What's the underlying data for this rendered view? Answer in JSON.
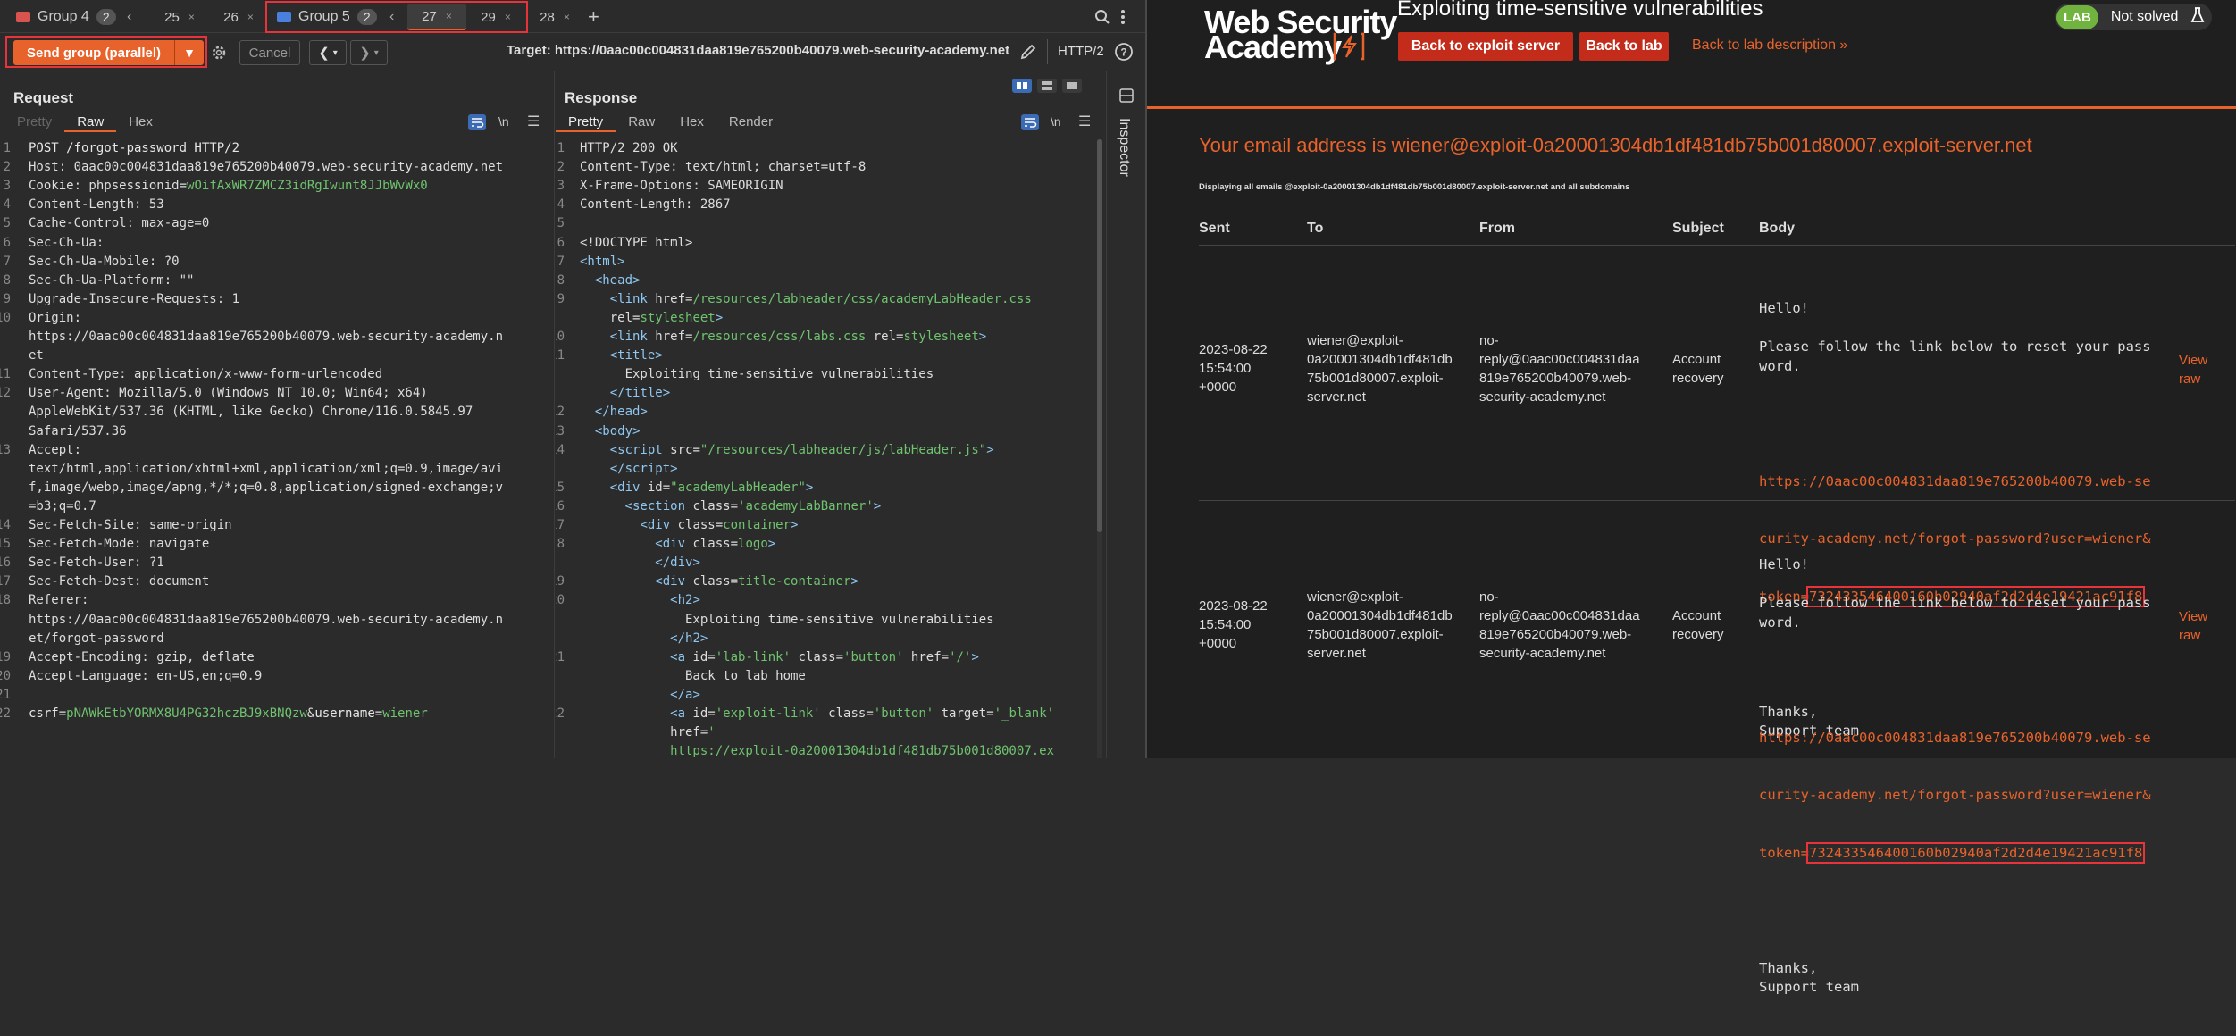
{
  "tabbar": {
    "group4": {
      "name": "Group 4",
      "count": "2"
    },
    "tab25": "25",
    "tab26": "26",
    "group5": {
      "name": "Group 5",
      "count": "2"
    },
    "tab27": "27",
    "tab29": "29",
    "tab28": "28",
    "close": "×",
    "add": "+",
    "prev": "‹"
  },
  "toolbar": {
    "send_label": "Send group (parallel)",
    "cancel_label": "Cancel",
    "target_label": "Target: https://0aac00c004831daa819e765200b40079.web-security-academy.net",
    "http_version": "HTTP/2"
  },
  "request": {
    "title": "Request",
    "tabs": [
      "Pretty",
      "Raw",
      "Hex"
    ],
    "newline_toggle": "\\n",
    "lines": [
      {
        "n": "1",
        "html": "<span class='k'>POST /forgot-password HTTP/2</span>"
      },
      {
        "n": "2",
        "html": "Host: 0aac00c004831daa819e765200b40079.web-security-academy.net"
      },
      {
        "n": "3",
        "html": "Cookie: phpsessionid=<span class='v'>wOifAxWR7ZMCZ3idRgIwunt8JJbWvWx0</span>"
      },
      {
        "n": "4",
        "html": "Content-Length: 53"
      },
      {
        "n": "5",
        "html": "Cache-Control: max-age=0"
      },
      {
        "n": "6",
        "html": "Sec-Ch-Ua: "
      },
      {
        "n": "7",
        "html": "Sec-Ch-Ua-Mobile: ?0"
      },
      {
        "n": "8",
        "html": "Sec-Ch-Ua-Platform: \"\""
      },
      {
        "n": "9",
        "html": "Upgrade-Insecure-Requests: 1"
      },
      {
        "n": "10",
        "html": "Origin: "
      },
      {
        "n": "",
        "html": "https://0aac00c004831daa819e765200b40079.web-security-academy.n"
      },
      {
        "n": "",
        "html": "et"
      },
      {
        "n": "11",
        "html": "Content-Type: application/x-www-form-urlencoded"
      },
      {
        "n": "12",
        "html": "User-Agent: Mozilla/5.0 (Windows NT 10.0; Win64; x64)"
      },
      {
        "n": "",
        "html": "AppleWebKit/537.36 (KHTML, like Gecko) Chrome/116.0.5845.97"
      },
      {
        "n": "",
        "html": "Safari/537.36"
      },
      {
        "n": "13",
        "html": "Accept: "
      },
      {
        "n": "",
        "html": "text/html,application/xhtml+xml,application/xml;q=0.9,image/avi"
      },
      {
        "n": "",
        "html": "f,image/webp,image/apng,*/*;q=0.8,application/signed-exchange;v"
      },
      {
        "n": "",
        "html": "=b3;q=0.7"
      },
      {
        "n": "14",
        "html": "Sec-Fetch-Site: same-origin"
      },
      {
        "n": "15",
        "html": "Sec-Fetch-Mode: navigate"
      },
      {
        "n": "16",
        "html": "Sec-Fetch-User: ?1"
      },
      {
        "n": "17",
        "html": "Sec-Fetch-Dest: document"
      },
      {
        "n": "18",
        "html": "Referer: "
      },
      {
        "n": "",
        "html": "https://0aac00c004831daa819e765200b40079.web-security-academy.n"
      },
      {
        "n": "",
        "html": "et/forgot-password"
      },
      {
        "n": "19",
        "html": "Accept-Encoding: gzip, deflate"
      },
      {
        "n": "20",
        "html": "Accept-Language: en-US,en;q=0.9"
      },
      {
        "n": "21",
        "html": ""
      },
      {
        "n": "22",
        "html": "<span class='k'>csrf</span>=<span class='v'>pNAWkEtbYORMX8U4PG32hczBJ9xBNQzw</span>&amp;<span class='k'>username</span>=<span class='v'>wiener</span>"
      }
    ]
  },
  "response": {
    "title": "Response",
    "tabs": [
      "Pretty",
      "Raw",
      "Hex",
      "Render"
    ],
    "newline_toggle": "\\n",
    "lines": [
      {
        "n": "1",
        "html": "HTTP/2 200 OK"
      },
      {
        "n": "2",
        "html": "Content-Type: text/html; charset=utf-8"
      },
      {
        "n": "3",
        "html": "X-Frame-Options: SAMEORIGIN"
      },
      {
        "n": "4",
        "html": "Content-Length: 2867"
      },
      {
        "n": "5",
        "html": ""
      },
      {
        "n": "6",
        "html": "&lt;!DOCTYPE html&gt;"
      },
      {
        "n": "7",
        "html": "<span class='tag'>&lt;html&gt;</span>"
      },
      {
        "n": "8",
        "html": "  <span class='tag'>&lt;head&gt;</span>"
      },
      {
        "n": "9",
        "html": "    <span class='tag'>&lt;link</span> href=<span class='str'>/resources/labheader/css/academyLabHeader.css</span>"
      },
      {
        "n": "",
        "html": "    rel=<span class='str'>stylesheet</span><span class='tag'>&gt;</span>"
      },
      {
        "n": "10",
        "html": "    <span class='tag'>&lt;link</span> href=<span class='str'>/resources/css/labs.css</span> rel=<span class='str'>stylesheet</span><span class='tag'>&gt;</span>"
      },
      {
        "n": "11",
        "html": "    <span class='tag'>&lt;title&gt;</span>"
      },
      {
        "n": "",
        "html": "      Exploiting time-sensitive vulnerabilities"
      },
      {
        "n": "",
        "html": "    <span class='tag'>&lt;/title&gt;</span>"
      },
      {
        "n": "12",
        "html": "  <span class='tag'>&lt;/head&gt;</span>"
      },
      {
        "n": "13",
        "html": "  <span class='tag'>&lt;body&gt;</span>"
      },
      {
        "n": "14",
        "html": "    <span class='tag'>&lt;script</span> src=<span class='str'>\"/resources/labheader/js/labHeader.js\"</span><span class='tag'>&gt;</span>"
      },
      {
        "n": "",
        "html": "    <span class='tag'>&lt;/script&gt;</span>"
      },
      {
        "n": "15",
        "html": "    <span class='tag'>&lt;div</span> id=<span class='str'>\"academyLabHeader\"</span><span class='tag'>&gt;</span>"
      },
      {
        "n": "16",
        "html": "      <span class='tag'>&lt;section</span> class=<span class='str'>'academyLabBanner'</span><span class='tag'>&gt;</span>"
      },
      {
        "n": "17",
        "html": "        <span class='tag'>&lt;div</span> class=<span class='str'>container</span><span class='tag'>&gt;</span>"
      },
      {
        "n": "18",
        "html": "          <span class='tag'>&lt;div</span> class=<span class='str'>logo</span><span class='tag'>&gt;</span>"
      },
      {
        "n": "",
        "html": "          <span class='tag'>&lt;/div&gt;</span>"
      },
      {
        "n": "19",
        "html": "          <span class='tag'>&lt;div</span> class=<span class='str'>title-container</span><span class='tag'>&gt;</span>"
      },
      {
        "n": "20",
        "html": "            <span class='tag'>&lt;h2&gt;</span>"
      },
      {
        "n": "",
        "html": "              Exploiting time-sensitive vulnerabilities"
      },
      {
        "n": "",
        "html": "            <span class='tag'>&lt;/h2&gt;</span>"
      },
      {
        "n": "21",
        "html": "            <span class='tag'>&lt;a</span> id=<span class='str'>'lab-link'</span> class=<span class='str'>'button'</span> href=<span class='str'>'/'</span><span class='tag'>&gt;</span>"
      },
      {
        "n": "",
        "html": "              Back to lab home"
      },
      {
        "n": "",
        "html": "            <span class='tag'>&lt;/a&gt;</span>"
      },
      {
        "n": "22",
        "html": "            <span class='tag'>&lt;a</span> id=<span class='str'>'exploit-link'</span> class=<span class='str'>'button'</span> target=<span class='str'>'_blank'</span>"
      },
      {
        "n": "",
        "html": "            href=<span class='str'>'</span>"
      },
      {
        "n": "",
        "html": "<span class='str'>            https://exploit-0a20001304db1df481db75b001d80007.ex</span>"
      }
    ]
  },
  "inspector": {
    "label": "Inspector"
  },
  "lab": {
    "logo_line1": "Web Security",
    "logo_line2": "Academy",
    "title": "Exploiting time-sensitive vulnerabilities",
    "back_exploit": "Back to exploit server",
    "back_lab": "Back to lab",
    "back_desc": "Back to lab description »",
    "lab_badge": "LAB",
    "status": "Not solved",
    "email_heading": "Your email address is wiener@exploit-0a20001304db1df481db75b001d80007.exploit-server.net",
    "email_sub": "Displaying all emails @exploit-0a20001304db1df481db75b001d80007.exploit-server.net and all subdomains",
    "columns": [
      "Sent",
      "To",
      "From",
      "Subject",
      "Body"
    ],
    "emails": [
      {
        "sent": "2023-08-22\n15:54:00\n+0000",
        "to": "wiener@exploit-\n0a20001304db1df481db\n75b001d80007.exploit-\nserver.net",
        "from": "no-\nreply@0aac00c004831daa\n819e765200b40079.web-\nsecurity-academy.net",
        "subject": "Account\nrecovery",
        "body_pre": "Hello!\n\nPlease follow the link below to reset your pass\nword.",
        "link_l1": "https://0aac00c004831daa819e765200b40079.web-se",
        "link_l2": "curity-academy.net/forgot-password?user=wiener&",
        "link_l3_pre": "token=",
        "token": "732433546400160b02940af2d2d4e19421ac91f8",
        "body_post": "Thanks,\nSupport team",
        "view_raw": "View\nraw"
      },
      {
        "sent": "2023-08-22\n15:54:00\n+0000",
        "to": "wiener@exploit-\n0a20001304db1df481db\n75b001d80007.exploit-\nserver.net",
        "from": "no-\nreply@0aac00c004831daa\n819e765200b40079.web-\nsecurity-academy.net",
        "subject": "Account\nrecovery",
        "body_pre": "Hello!\n\nPlease follow the link below to reset your pass\nword.",
        "link_l1": "https://0aac00c004831daa819e765200b40079.web-se",
        "link_l2": "curity-academy.net/forgot-password?user=wiener&",
        "link_l3_pre": "token=",
        "token": "732433546400160b02940af2d2d4e19421ac91f8",
        "body_post": "Thanks,\nSupport team",
        "view_raw": "View\nraw"
      }
    ]
  },
  "colors": {
    "accent": "#e8632b",
    "highlight_box": "#e8333a",
    "lab_button": "#c32b1a",
    "lab_badge": "#70b33e"
  }
}
